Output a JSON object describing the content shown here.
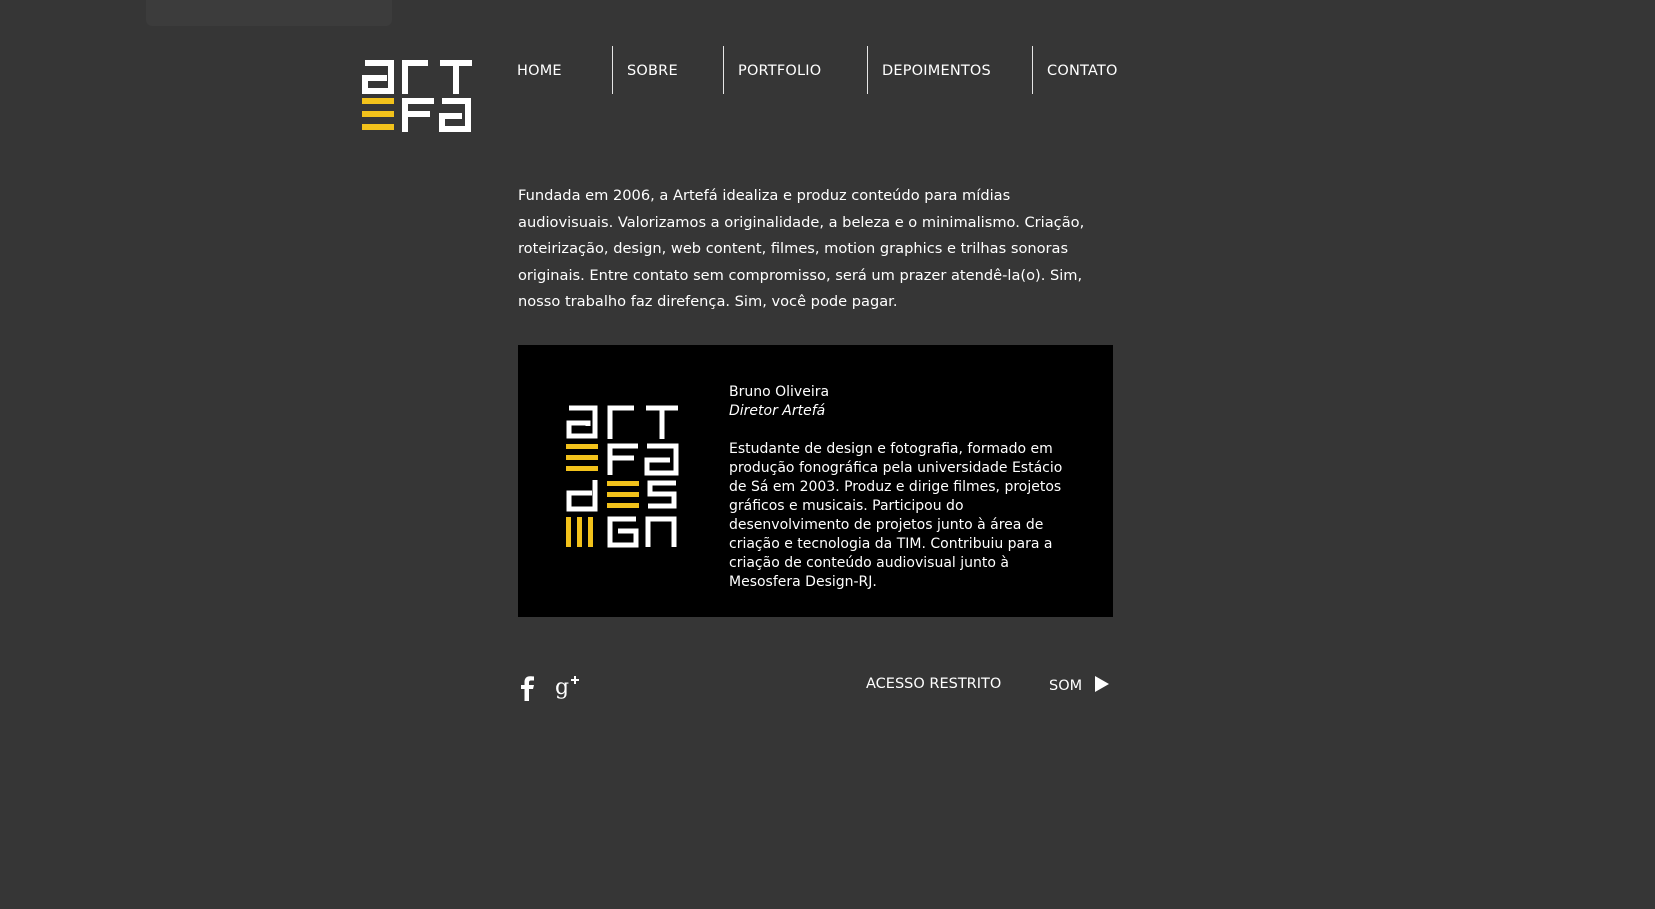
{
  "brand": {
    "logo_alt": "artefá",
    "accent_color": "#f2c21b"
  },
  "nav": {
    "items": [
      {
        "label": "HOME"
      },
      {
        "label": "SOBRE"
      },
      {
        "label": "PORTFOLIO"
      },
      {
        "label": "DEPOIMENTOS"
      },
      {
        "label": "CONTATO"
      }
    ]
  },
  "intro": {
    "text": "Fundada em 2006, a Artefá idealiza e produz conteúdo para mídias audiovisuais. Valorizamos a originalidade, a beleza e o minimalismo. Criação, roteirização, design, web content, filmes, motion graphics e  trilhas sonoras originais. Entre contato sem compromisso, será um prazer atendê-la(o). Sim, nosso trabalho faz direfença. Sim, você pode pagar."
  },
  "profile": {
    "logo_alt": "artefá design",
    "name": "Bruno Oliveira",
    "role": "Diretor Artefá",
    "bio": "Estudante de design e fotografia, formado em produção fonográfica pela universidade Estácio de Sá em 2003. Produz e dirige filmes, projetos gráficos e musicais. Participou do desenvolvimento de projetos junto à área de criação e tecnologia da TIM. Contribuiu para a criação de conteúdo audiovisual junto à Mesosfera Design-RJ."
  },
  "footer": {
    "social": [
      {
        "icon": "facebook-icon"
      },
      {
        "icon": "google-plus-icon"
      }
    ],
    "restricted_label": "ACESSO RESTRITO",
    "sound_label": "SOM",
    "sound_icon": "play-icon"
  }
}
